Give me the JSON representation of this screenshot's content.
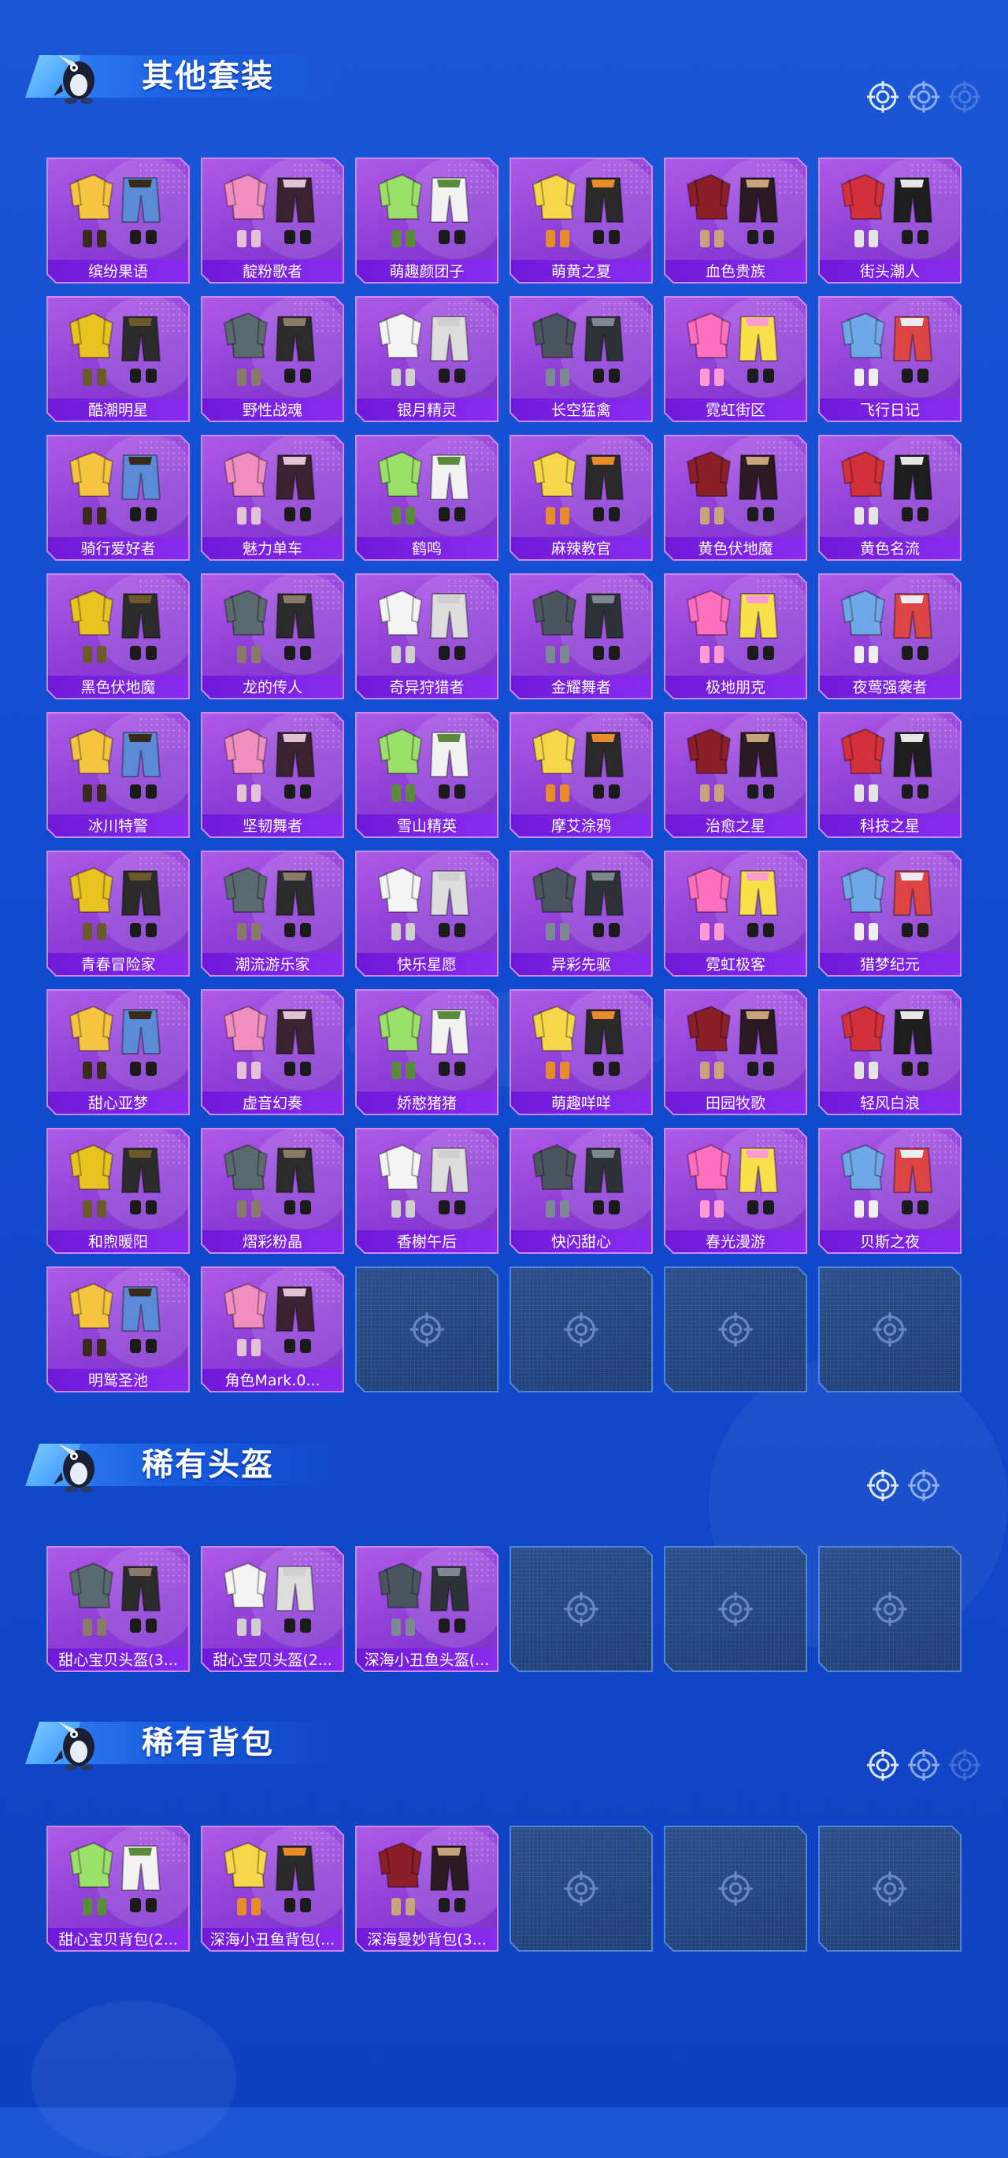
{
  "sections": [
    {
      "title": "其他套装",
      "items": [
        "缤纷果语",
        "靛粉歌者",
        "萌趣颜团子",
        "萌黄之夏",
        "血色贵族",
        "街头潮人",
        "酷潮明星",
        "野性战魂",
        "银月精灵",
        "长空猛禽",
        "霓虹街区",
        "飞行日记",
        "骑行爱好者",
        "魅力单车",
        "鹤鸣",
        "麻辣教官",
        "黄色伏地魔",
        "黄色名流",
        "黑色伏地魔",
        "龙的传人",
        "奇异狩猎者",
        "金耀舞者",
        "极地朋克",
        "夜莺强袭者",
        "冰川特警",
        "坚韧舞者",
        "雪山精英",
        "摩艾涂鸦",
        "治愈之星",
        "科技之星",
        "青春冒险家",
        "潮流游乐家",
        "快乐星愿",
        "异彩先驱",
        "霓虹极客",
        "猎梦纪元",
        "甜心亚梦",
        "虚音幻奏",
        "娇憨猪猪",
        "萌趣咩咩",
        "田园牧歌",
        "轻风白浪",
        "和煦暖阳",
        "熠彩粉晶",
        "香榭午后",
        "快闪甜心",
        "春光漫游",
        "贝斯之夜",
        "明鹫圣池",
        "角色Mark.0..."
      ],
      "empty_slots": 4
    },
    {
      "title": "稀有头盔",
      "items": [
        "甜心宝贝头盔(3...",
        "甜心宝贝头盔(2...",
        "深海小丑鱼头盔(..."
      ],
      "empty_slots": 3
    },
    {
      "title": "稀有背包",
      "items": [
        "甜心宝贝背包(2...",
        "深海小丑鱼背包(...",
        "深海曼妙背包(3..."
      ],
      "empty_slots": 3
    }
  ],
  "colors": {
    "background": "#1a56d6",
    "tile_purple": "#9a48dc",
    "name_bar": "#7a20e0",
    "empty_tile": "#24457f",
    "tile_border": "#5aa8ff"
  },
  "icons": {
    "header_deco": "target-crosshair-icon",
    "empty_slot": "crosshair-placeholder-icon",
    "mascot": "penguin-mascot-icon"
  }
}
